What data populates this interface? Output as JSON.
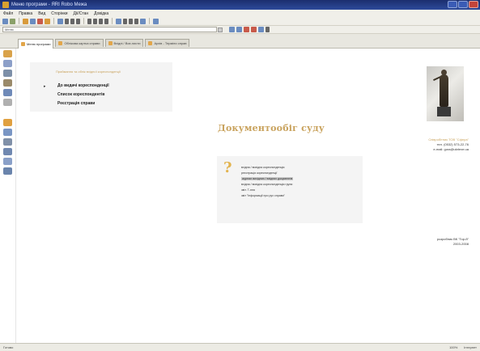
{
  "window": {
    "title": "Меню програми - ЯRI Robo Межа"
  },
  "menubar": {
    "items": [
      "Файл",
      "Правка",
      "Вид",
      "Сторінки",
      "Дії/Стан",
      "Довідка"
    ]
  },
  "addressbar": {
    "value": "Меню"
  },
  "tabs": [
    {
      "label": "Меню програми",
      "active": true
    },
    {
      "label": "Облікова картка справи",
      "active": false
    },
    {
      "label": "Вхідні / Вих.листи",
      "active": false
    },
    {
      "label": "Архів - Терміни справ",
      "active": false
    }
  ],
  "menu": {
    "header": "Приймання та облік вхідної кореспонденції",
    "items": [
      "До видачі кореспонденції",
      "Список кореспондентів",
      "Реєстрація справи"
    ]
  },
  "main": {
    "title": "Документообіг суду"
  },
  "contact": {
    "name": "Співробітник ТОВ \"Сфера\"",
    "phone": "тел. (0532) 573-22-76",
    "email": "e-mail: gora@ukrlexe.ua"
  },
  "info": {
    "lines": [
      "вхідна / вихідна кореспонденція",
      "реєстрація кореспонденції",
      "журнал вихідних / вхідних документів",
      "вхідна / вихідна кореспонденція групи",
      "звіт. Т-ння",
      "звіт \"Інформації про рух справи\""
    ]
  },
  "developer": {
    "line1": "розробник ВК \"Гор-й\"",
    "line2": "2003-2008"
  },
  "status": {
    "left": "Готово",
    "zoom": "100%",
    "right": "Інтернет"
  },
  "colors": {
    "accent": "#c9a35e",
    "panel": "#f4f4f4"
  }
}
